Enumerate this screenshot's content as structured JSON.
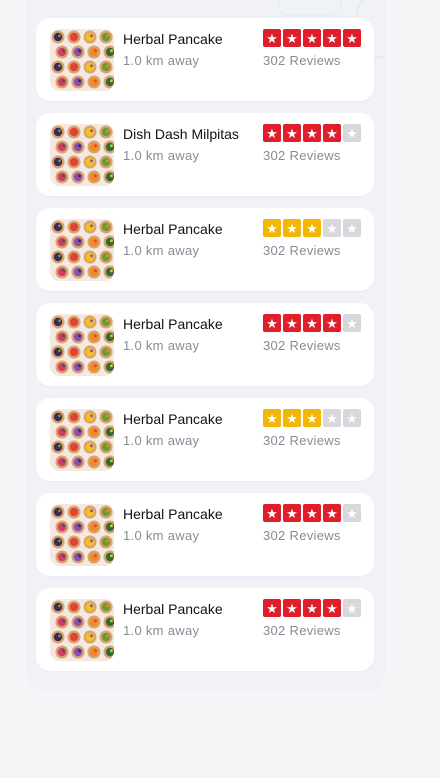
{
  "restaurants": [
    {
      "name": "Herbal Pancake",
      "distance": "1.0 km away",
      "reviews": "302 Reviews",
      "rating": 5,
      "star_color": "red"
    },
    {
      "name": "Dish Dash Milpitas",
      "distance": "1.0 km away",
      "reviews": "302 Reviews",
      "rating": 4,
      "star_color": "red"
    },
    {
      "name": "Herbal Pancake",
      "distance": "1.0 km away",
      "reviews": "302 Reviews",
      "rating": 3,
      "star_color": "yellow"
    },
    {
      "name": "Herbal Pancake",
      "distance": "1.0 km away",
      "reviews": "302 Reviews",
      "rating": 4,
      "star_color": "red"
    },
    {
      "name": "Herbal Pancake",
      "distance": "1.0 km away",
      "reviews": "302 Reviews",
      "rating": 3,
      "star_color": "yellow"
    },
    {
      "name": "Herbal Pancake",
      "distance": "1.0 km away",
      "reviews": "302 Reviews",
      "rating": 4,
      "star_color": "red"
    },
    {
      "name": "Herbal Pancake",
      "distance": "1.0 km away",
      "reviews": "302 Reviews",
      "rating": 4,
      "star_color": "red"
    }
  ],
  "max_rating": 5,
  "colors": {
    "star_red": "#e01e2b",
    "star_yellow": "#f2b705",
    "star_empty": "#d8d8dc"
  },
  "icons": {
    "star": "star-icon",
    "thumbnail": "food-thumbnail"
  }
}
